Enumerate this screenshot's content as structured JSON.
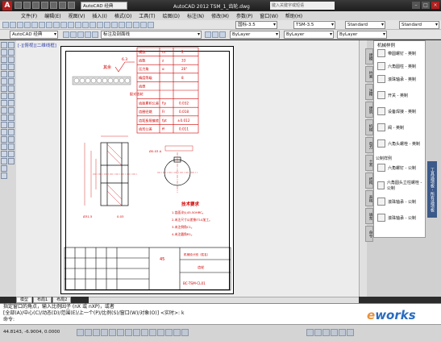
{
  "app": {
    "logo": "A",
    "workspace": "AutoCAD 经典",
    "title": "AutoCAD 2012    TSM_1_齿轮.dwg",
    "search_placeholder": "键入关键字或短语"
  },
  "menu": [
    "文件(F)",
    "编辑(E)",
    "视图(V)",
    "插入(I)",
    "格式(O)",
    "工具(T)",
    "绘图(D)",
    "标注(N)",
    "修改(M)",
    "参数(P)",
    "窗口(W)",
    "帮助(H)"
  ],
  "toolbar1": {
    "textstyle": "国标-3.5",
    "dimstyle": "TSM-3.5",
    "tablestyle": "Standard",
    "mlstyle": "Standard"
  },
  "toolbar2": {
    "workspace": "AutoCAD 经典",
    "layer_state": "标注及剖面线",
    "color": "ByLayer",
    "linetype": "ByLayer",
    "lineweight": "ByLayer"
  },
  "viewport_label": "[-][俯视][二维线框]",
  "drawing": {
    "surface_roughness": "6.3",
    "other_label": "其余",
    "param_table": [
      {
        "name": "模数",
        "sym": "m",
        "val": "2"
      },
      {
        "name": "齿数",
        "sym": "z",
        "val": "33"
      },
      {
        "name": "压力角",
        "sym": "α",
        "val": "20°"
      },
      {
        "name": "精度等级",
        "sym": "",
        "val": "8"
      },
      {
        "name": "齿厚",
        "sym": "",
        "val": ""
      },
      {
        "name": "",
        "sym": "",
        "val": ""
      },
      {
        "name": "齿距累积公差",
        "sym": "Fp",
        "val": "0.032"
      },
      {
        "name": "齿圈径跳",
        "sym": "Fr",
        "val": "0.018"
      },
      {
        "name": "齿距极限偏差",
        "sym": "fpt",
        "val": "±0.012"
      },
      {
        "name": "齿形公差",
        "sym": "ff",
        "val": "0.011"
      }
    ],
    "side_label": "配对齿轮",
    "tech_title": "技术要求",
    "tech_items": [
      "1.齿面淬火45-50HRC。",
      "2.未注尺寸公差按IT14加工。",
      "3.未注倒角C1。",
      "4.未注圆角R1。"
    ],
    "material": "45",
    "part_name": "齿轮",
    "drawing_no": "BC-TSM-CL01",
    "school": "机械设计班（姓名）",
    "dim_a": "Ø31.5",
    "dim_b": "0.03",
    "dim_c": "Ø0.03 A"
  },
  "palette": {
    "header": "机械样例",
    "items": [
      "带圆螺钉 - 英制",
      "六角圆柱 - 英制",
      "滚珠轴承 - 英制",
      "开关 - 英制",
      "设备焊接 - 英制",
      "阀 - 英制",
      "六角头螺栓 - 英制"
    ],
    "section2": "公制样例",
    "items2": [
      "六角螺钉 - 公制",
      "六角圆头立柱螺栓 - 公制",
      "滚珠轴承 - 公制",
      "滚珠轴承 - 公制"
    ],
    "side_tabs": [
      "建模",
      "约束",
      "注释",
      "建筑",
      "机械",
      "电力",
      "土木",
      "结构",
      "表格",
      "填充",
      "命令"
    ],
    "vertical_title": "工具选项板 - 所有选项板"
  },
  "layout_tabs": [
    "模型",
    "布局1",
    "布局2"
  ],
  "command": {
    "line1": "指定窗口的角点，输入比例因子 (nX 或 nXP)，或者",
    "line2": "[全部(A)/中心(C)/动态(D)/范围(E)/上一个(P)/比例(S)/窗口(W)/对象(O)] <实时>: k",
    "prompt": "命令:"
  },
  "status": {
    "coords": "44.8143, -6.9004, 0.0000"
  },
  "watermark": {
    "e": "e",
    "rest": "works"
  }
}
